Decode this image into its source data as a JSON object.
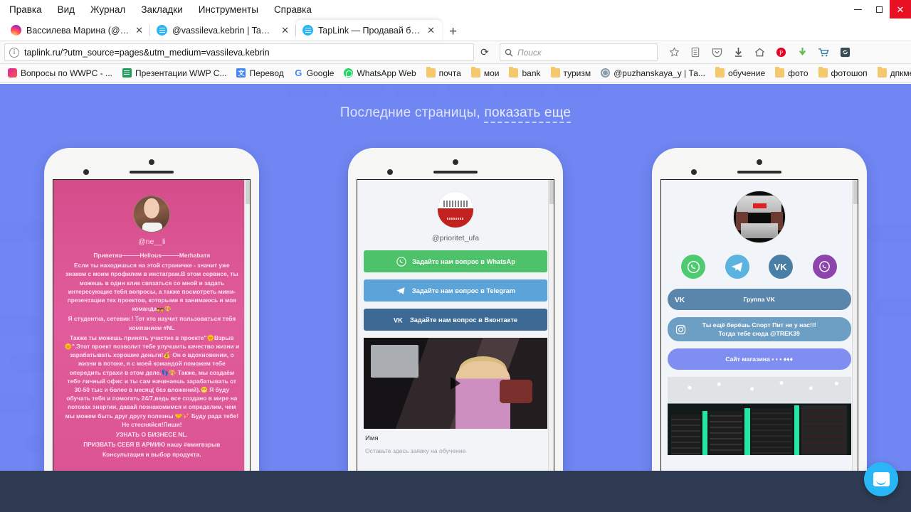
{
  "window": {
    "menu": [
      "Правка",
      "Вид",
      "Журнал",
      "Закладки",
      "Инструменты",
      "Справка"
    ],
    "controls": {
      "minimize": "—",
      "maximize": "▢",
      "close": "✕"
    }
  },
  "tabs": [
    {
      "title": "Вассилева Марина (@vas...",
      "favicon": "instagram-icon",
      "active": false,
      "close": "✕"
    },
    {
      "title": "@vassileva.kebrin | Taplin...",
      "favicon": "taplink-icon",
      "active": false,
      "close": "✕"
    },
    {
      "title": "TapLink — Продавай бол...",
      "favicon": "taplink-icon",
      "active": true,
      "close": "✕"
    }
  ],
  "newtab_label": "+",
  "navbar": {
    "url": "taplink.ru/?utm_source=pages&utm_medium=vassileva.kebrin",
    "info_icon": "i",
    "reload_icon": "⟳",
    "search_placeholder": "Поиск",
    "search_icon": "search-icon",
    "tools": [
      "star-icon",
      "library-icon",
      "pocket-icon",
      "download-icon",
      "home-icon",
      "pinterest-icon",
      "downloadhelper-icon",
      "cart-icon",
      "screenshot-icon"
    ]
  },
  "bookmarks": [
    {
      "label": "Вопросы по WWPC - ...",
      "icon": "instagram-icon"
    },
    {
      "label": "Презентации WWP C...",
      "icon": "sheets-icon"
    },
    {
      "label": "Перевод",
      "icon": "translate-icon"
    },
    {
      "label": "Google",
      "icon": "google-icon"
    },
    {
      "label": "WhatsApp Web",
      "icon": "whatsapp-icon"
    },
    {
      "label": "почта",
      "icon": "folder-icon"
    },
    {
      "label": "мои",
      "icon": "folder-icon"
    },
    {
      "label": "bank",
      "icon": "folder-icon"
    },
    {
      "label": "туризм",
      "icon": "folder-icon"
    },
    {
      "label": "@puzhanskaya_y | Та...",
      "icon": "globe-icon"
    },
    {
      "label": "обучение",
      "icon": "folder-icon"
    },
    {
      "label": "фото",
      "icon": "folder-icon"
    },
    {
      "label": "фотошоп",
      "icon": "folder-icon"
    },
    {
      "label": "дпкмент",
      "icon": "folder-icon"
    }
  ],
  "page": {
    "heading_text": "Последние страницы, ",
    "heading_link": "показать еще",
    "bg_color": "#7086f2",
    "bottom_bar_color": "#2e3b52",
    "chat_widget": {
      "icon": "chat-bubble-icon",
      "color": "#29b6f6"
    }
  },
  "phone1": {
    "handle": "@ne__li",
    "bg_color": "#d94f8e",
    "avatar": "woman-portrait-avatar",
    "paragraphs": [
      "Приветяu———Hellous———Merhabaтя",
      "Если ты находишься на этой страничке - значит уже знаком с моим профилем в инстаграм.В этом сервисе, ты можешь в один клик связаться со мной и задать интересующие тебя вопросы, а также посмотреть мини-презентации тех проектов, которыми я занимаюсь и моя команда💑🎨",
      "Я студентка, сетевик ! Тот кто научит пользоваться тебя компанием #NL",
      "Также ты можешь принять участие в проекте\"🌞Взрыв🌞\".Этот проект позволит тебе улучшить качество жизни и зарабатывать хорошие деньги!💰 Он о вдохновении, о жизни в потоке, я с моей командой поможем тебе опередить страхи в этом деле.👣🎨 Также, мы создаём тебе личный офис и ты сам начинаешь зарабатывать от 30-50 тыс и более в месяц( без вложений).😬 Я буду обучать тебя и помогать 24/7,ведь все создано в мире на потоках энергии, давай познакомимся и определим, чем мы можем быть друг другу полезны 🤝💖 Буду рада тебе!Не стесняйся!Пиши!",
      "УЗНАТЬ О БИЗНЕСЕ NL.",
      "ПРИЗВАТЬ СЕБЯ В АРМИЮ нашу #вмигвзрыв",
      "Консультация и выбор продукта."
    ]
  },
  "phone2": {
    "handle": "@prioritet_ufa",
    "logo": "prioritet-logo",
    "buttons": [
      {
        "label": "Задайте нам вопрос в WhatsAp",
        "icon": "whatsapp-icon",
        "color": "#4ec16b"
      },
      {
        "label": "Задайте нам вопрос в Telegram",
        "icon": "telegram-icon",
        "color": "#5ba3d9"
      },
      {
        "label": "Задайте нам вопрос в Вконтакте",
        "icon": "vk-icon",
        "color": "#3c6a95"
      }
    ],
    "video": {
      "thumbnail": "woman-in-car-video",
      "play_icon": "play-icon"
    },
    "form": {
      "label": "Имя",
      "placeholder": "Оставьте здесь заявку на обучение"
    }
  },
  "phone3": {
    "avatar": "store-interior-avatar",
    "socials": [
      {
        "icon": "whatsapp-icon",
        "color": "#4ecb71"
      },
      {
        "icon": "telegram-icon",
        "color": "#5bb3e0"
      },
      {
        "icon": "vk-icon",
        "color": "#4a7fa5"
      },
      {
        "icon": "viber-icon",
        "color": "#8e44ad"
      }
    ],
    "buttons": [
      {
        "label": "Группа VK",
        "icon": "vk-icon",
        "color": "#5b86ab"
      },
      {
        "label": "Ты ещё берёшь Спорт Пит не у нас!!! Тогда тебе сюда @TREK39",
        "icon": "instagram-icon",
        "color": "#6d9ec4"
      },
      {
        "label": "Сайт магазина ▪ ▪ ▪ ♦♦♦",
        "icon": "",
        "color": "#7f8ef0"
      }
    ],
    "image": "sport-nutrition-store-photo"
  }
}
